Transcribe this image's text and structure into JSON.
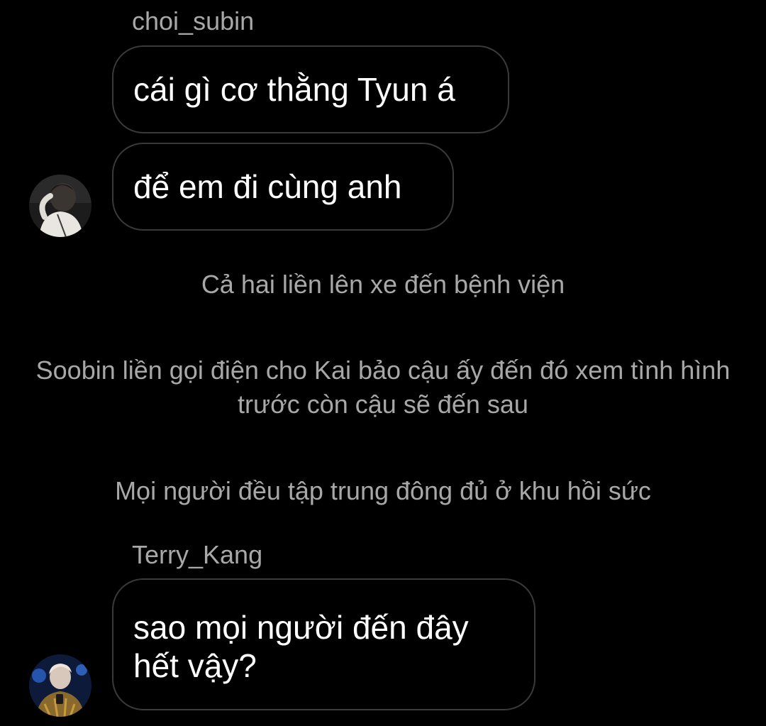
{
  "thread": {
    "group1": {
      "sender": "choi_subin",
      "avatar_icon": "user-avatar-choi-subin",
      "messages": [
        "cái gì cơ thằng Tyun á",
        "để em đi cùng anh"
      ]
    },
    "system_messages": [
      "Cả hai liền lên xe đến bệnh viện",
      "Soobin liền gọi điện cho Kai bảo cậu ấy đến đó xem tình hình trước còn cậu sẽ đến sau",
      "Mọi người đều tập trung đông đủ ở khu hồi sức"
    ],
    "group2": {
      "sender": "Terry_Kang",
      "avatar_icon": "user-avatar-terry-kang",
      "messages": [
        "sao mọi người đến đây hết vậy?"
      ]
    }
  },
  "colors": {
    "background": "#000000",
    "bubble_border": "#3a3a3a",
    "secondary_text": "#a8a8a8",
    "primary_text": "#ffffff"
  }
}
